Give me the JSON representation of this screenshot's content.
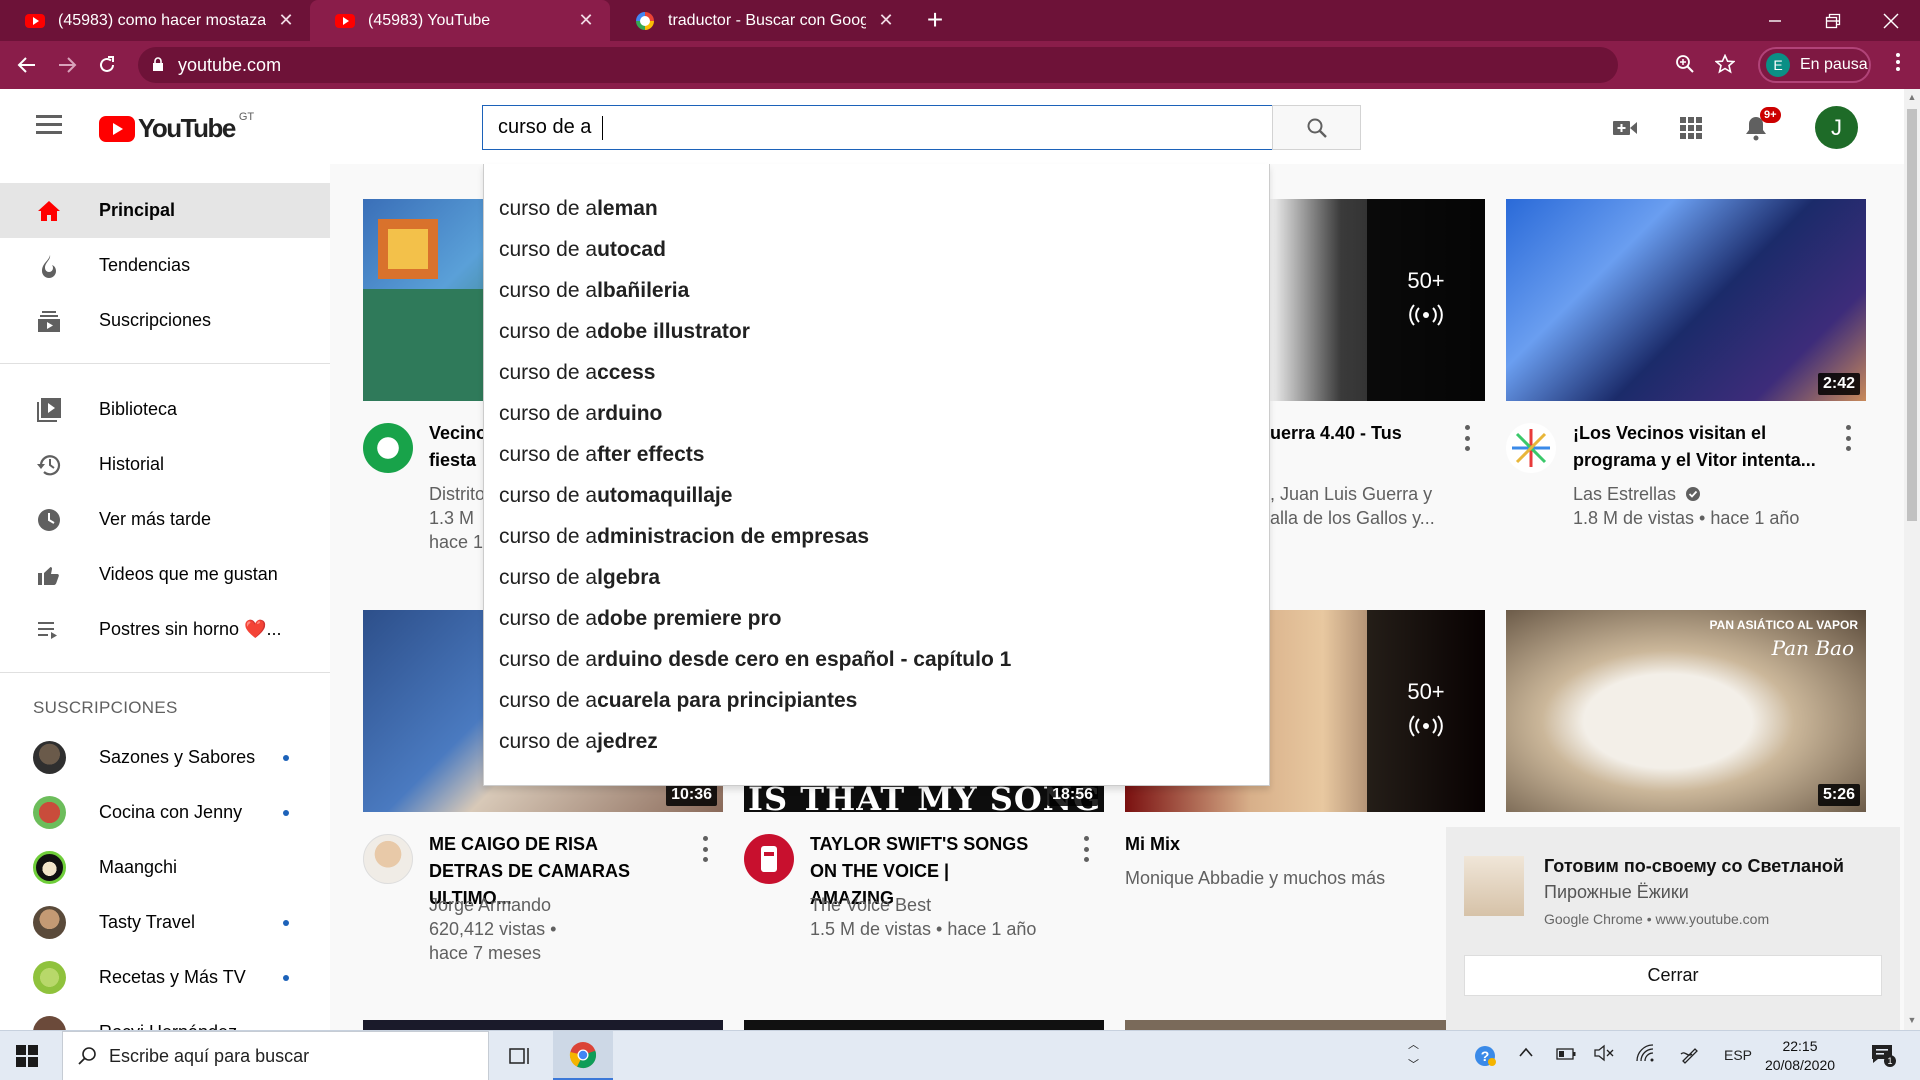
{
  "browser": {
    "tabs": [
      {
        "title": "(45983) como hacer mostaza casera",
        "close": "✕"
      },
      {
        "title": "(45983) YouTube",
        "close": "✕"
      },
      {
        "title": "traductor - Buscar con Google",
        "close": "✕"
      }
    ],
    "new_tab": "+",
    "url": "youtube.com",
    "profile_initial": "E",
    "profile_status": "En pausa"
  },
  "youtube": {
    "logo_text": "YouTube",
    "country_code": "GT",
    "search_value": "curso de a",
    "notification_count": "9+",
    "user_initial": "J",
    "suggestion_prefix": "curso de a",
    "suggestions": [
      "leman",
      "utocad",
      "lbañileria",
      "dobe illustrator",
      "ccess",
      "rduino",
      "fter effects",
      "utomaquillaje",
      "dministracion de empresas",
      "lgebra",
      "dobe premiere pro",
      "rduino desde cero en español - capítulo 1",
      "cuarela para principiantes",
      "jedrez"
    ]
  },
  "sidebar": {
    "main": [
      {
        "label": "Principal"
      },
      {
        "label": "Tendencias"
      },
      {
        "label": "Suscripciones"
      }
    ],
    "library": [
      {
        "label": "Biblioteca"
      },
      {
        "label": "Historial"
      },
      {
        "label": "Ver más tarde"
      },
      {
        "label": "Videos que me gustan"
      },
      {
        "label": "Postres sin horno ❤️..."
      }
    ],
    "subscriptions_header": "SUSCRIPCIONES",
    "subscriptions": [
      {
        "label": "Sazones y Sabores",
        "new": true
      },
      {
        "label": "Cocina con Jenny",
        "new": true
      },
      {
        "label": "Maangchi",
        "new": false
      },
      {
        "label": "Tasty Travel",
        "new": true
      },
      {
        "label": "Recetas y Más TV",
        "new": true
      },
      {
        "label": "Rocyi Hernández",
        "new": false
      }
    ]
  },
  "videos": {
    "row1": [
      {
        "title_1": "Vecino",
        "title_2": "fiesta",
        "meta_1": "Distrito",
        "meta_2": "1.3 M",
        "meta_3": "hace 1"
      },
      {
        "title_1": "uerra 4.40 - Tus",
        "meta_1": ", Juan Luis Guerra y",
        "meta_2": "alla de los Gallos y...",
        "mix_count": "50+"
      },
      {
        "title": "¡Los Vecinos visitan el programa y el Vitor intenta...",
        "channel": "Las Estrellas",
        "views": "1.8 M de vistas • hace 1 año",
        "duration": "2:42"
      }
    ],
    "row2": [
      {
        "title": "ME CAIGO DE RISA DETRAS DE CAMARAS ULTIMO...",
        "channel": "Jorge Armando",
        "views": "620,412 vistas •",
        "age": "hace 7 meses",
        "duration": "10:36"
      },
      {
        "title": "TAYLOR SWIFT'S SONGS ON THE VOICE | AMAZING",
        "channel": "The Voice Best",
        "views": "1.5 M de vistas • hace 1 año",
        "duration": "18:56",
        "thumb_text": "IS THAT MY SONG"
      },
      {
        "title": "Mi Mix",
        "channel": "Monique Abbadie y muchos más",
        "mix_count": "50+"
      },
      {
        "duration": "5:26",
        "thumb_text_1": "PAN ASIÁTICO AL VAPOR",
        "thumb_text_2": "Pan Bao"
      }
    ]
  },
  "notification": {
    "title": "Готовим по-своему со Светланой",
    "subtitle": "Пирожные Ёжики",
    "source": "Google Chrome • www.youtube.com",
    "button": "Cerrar"
  },
  "taskbar": {
    "search_placeholder": "Escribe aquí para buscar",
    "lang": "ESP",
    "time": "22:15",
    "date": "20/08/2020"
  },
  "colors": {
    "chrome_frame": "#6d1238",
    "chrome_toolbar": "#8a1d4a",
    "youtube_red": "#ff0000",
    "search_focus": "#1c62b9"
  }
}
